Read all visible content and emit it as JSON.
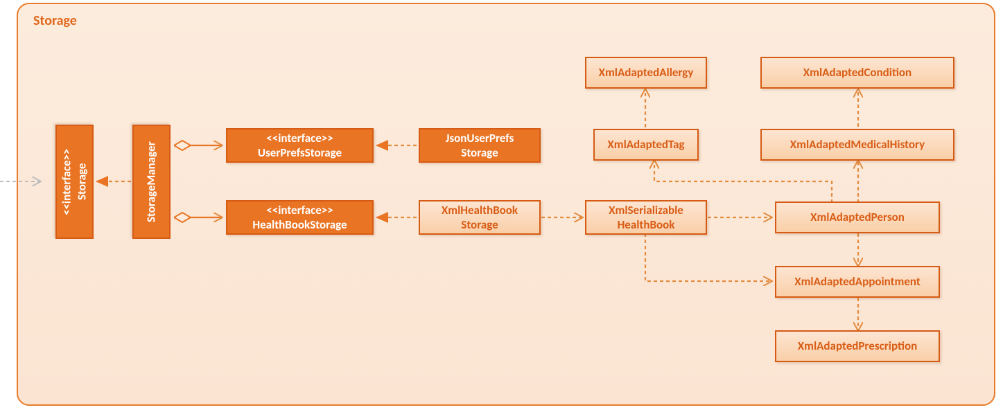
{
  "package": {
    "title": "Storage"
  },
  "boxes": {
    "storageIf": {
      "stereotype": "<<interface>>",
      "name": "Storage"
    },
    "storageManager": {
      "name": "StorageManager"
    },
    "userPrefsIf": {
      "stereotype": "<<interface>>",
      "name": "UserPrefsStorage"
    },
    "healthBookIf": {
      "stereotype": "<<interface>>",
      "name": "HealthBookStorage"
    },
    "jsonUserPrefs": {
      "line1": "JsonUserPrefs",
      "line2": "Storage"
    },
    "xmlHBStorage": {
      "line1": "XmlHealthBook",
      "line2": "Storage"
    },
    "xmlSerHB": {
      "line1": "XmlSerializable",
      "line2": "HealthBook"
    },
    "xmlAllergy": {
      "name": "XmlAdaptedAllergy"
    },
    "xmlCondition": {
      "name": "XmlAdaptedCondition"
    },
    "xmlTag": {
      "name": "XmlAdaptedTag"
    },
    "xmlMedHist": {
      "name": "XmlAdaptedMedicalHistory"
    },
    "xmlPerson": {
      "name": "XmlAdaptedPerson"
    },
    "xmlAppt": {
      "name": "XmlAdaptedAppointment"
    },
    "xmlPresc": {
      "name": "XmlAdaptedPrescription"
    }
  }
}
